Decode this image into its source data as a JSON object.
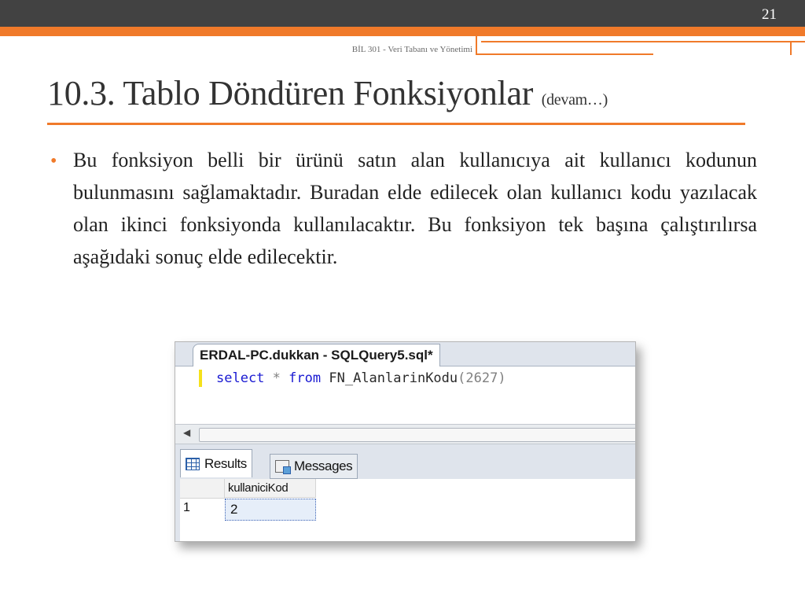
{
  "header": {
    "slide_number": "21",
    "course": "BİL 301 - Veri Tabanı ve Yönetimi"
  },
  "title": {
    "main": "10.3. Tablo Döndüren Fonksiyonlar",
    "sub": "(devam…)"
  },
  "body": {
    "bullet": "Bu fonksiyon belli bir ürünü satın alan kullanıcıya ait kullanıcı kodunun bulunmasını sağlamaktadır. Buradan elde edilecek olan kullanıcı kodu yazılacak olan ikinci fonksiyonda kullanılacaktır. Bu fonksiyon tek başına çalıştırılırsa aşağıdaki sonuç elde edilecektir."
  },
  "screenshot": {
    "doc_tab": "ERDAL-PC.dukkan - SQLQuery5.sql*",
    "code": {
      "kw1": "select",
      "star": "*",
      "kw2": "from",
      "fn": "FN_AlanlarinKodu",
      "args": "(2627)"
    },
    "tabs": {
      "results": "Results",
      "messages": "Messages"
    },
    "grid": {
      "column": "kullaniciKod",
      "row_number": "1",
      "value": "2"
    }
  },
  "colors": {
    "accent": "#f07a2a",
    "dark_band": "#424242",
    "keyword": "#1919d2"
  }
}
